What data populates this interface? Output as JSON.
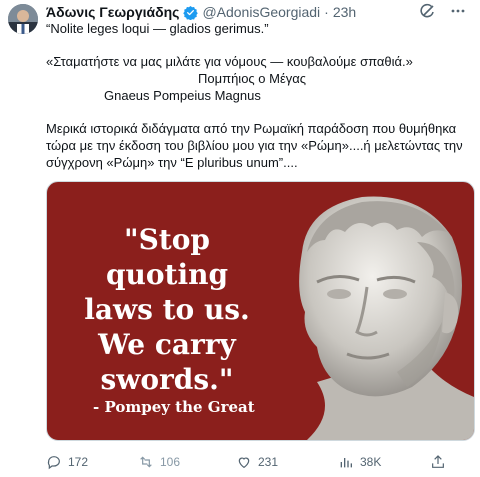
{
  "author": {
    "name": "Άδωνις Γεωργιάδης",
    "handle": "@AdonisGeorgiadi",
    "separator": "·",
    "time": "23h"
  },
  "tweet": {
    "lines": [
      "“Nolite leges loqui — gladios gerimus.”",
      "«Σταματήστε να μας μιλάτε για νόμους — κουβαλούμε σπαθιά.»",
      "Πομπήιος ο Μέγας",
      "Gnaeus Pompeius Magnus",
      "Μερικά ιστορικά διδάγματα από την Ρωμαϊκή παράδοση που θυμήθηκα",
      "τώρα με την έκδοση του βιβλίου μου για την «Ρώμη»....ή μελετώντας την",
      "σύγχρονη «Ρώμη» την “E pluribus unum”...."
    ]
  },
  "media": {
    "quote_lines": [
      "\"Stop",
      "quoting",
      "laws to us.",
      "We carry",
      "swords.\""
    ],
    "attribution": "- Pompey the Great",
    "background_color": "#8b1f1c"
  },
  "actions": {
    "replies": "172",
    "retweets": "106",
    "likes": "231",
    "views": "38K"
  },
  "icons": [
    "verified-badge-icon",
    "grok-icon",
    "more-icon",
    "reply-icon",
    "retweet-icon",
    "like-icon",
    "views-icon",
    "share-icon"
  ]
}
